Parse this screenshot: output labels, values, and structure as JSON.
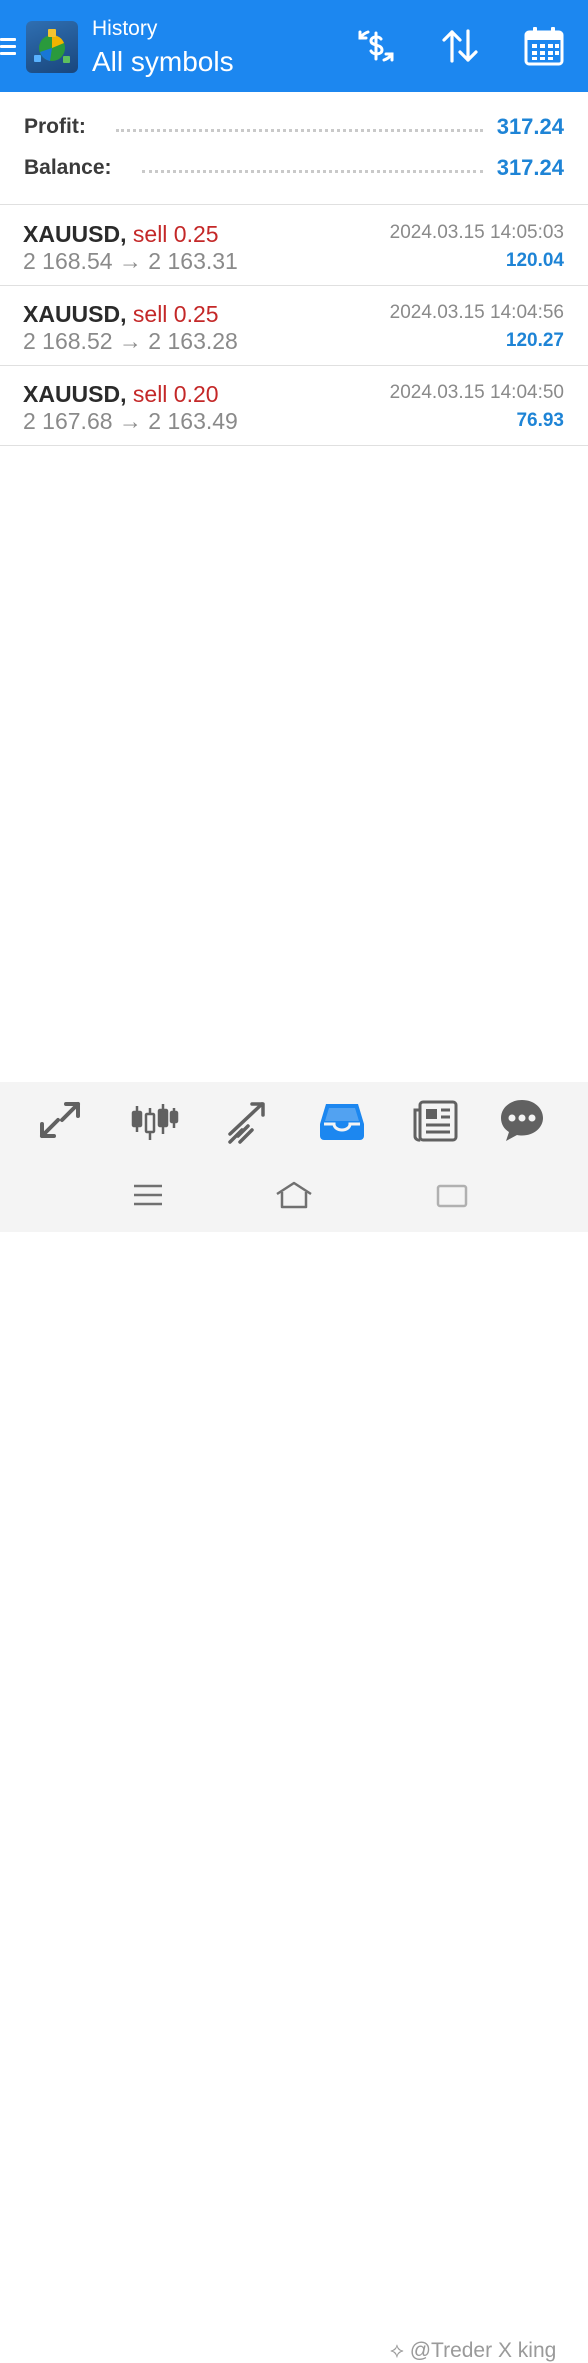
{
  "header": {
    "subtitle": "History",
    "title": "All symbols",
    "icons": [
      "menu-icon",
      "metatrader-logo",
      "dollar-exchange-icon",
      "sort-icon",
      "calendar-icon"
    ],
    "color": "#1c87f0"
  },
  "summary": {
    "profit_label": "Profit:",
    "profit_value": "317.24",
    "balance_label": "Balance:",
    "balance_value": "317.24"
  },
  "deals": [
    {
      "symbol": "XAUUSD,",
      "side": "sell 0.25",
      "prices": "2 168.54 → 2 163.31",
      "time": "2024.03.15 14:05:03",
      "profit": "120.04"
    },
    {
      "symbol": "XAUUSD,",
      "side": "sell 0.25",
      "prices": "2 168.52 → 2 163.28",
      "time": "2024.03.15 14:04:56",
      "profit": "120.27"
    },
    {
      "symbol": "XAUUSD,",
      "side": "sell 0.20",
      "prices": "2 167.68 → 2 163.49",
      "time": "2024.03.15 14:04:50",
      "profit": "76.93"
    }
  ],
  "bottom_nav": {
    "items": [
      "quotes-icon",
      "chart-icon",
      "trade-icon",
      "history-icon",
      "news-icon",
      "chat-icon"
    ],
    "active": "history-icon",
    "active_color": "#1c87f0"
  },
  "system_nav": [
    "recent-apps-icon",
    "home-icon",
    "back-icon"
  ],
  "watermark": "⟡ @Treder X king",
  "colors": {
    "profit": "#1e84d6",
    "sell": "#c42828"
  }
}
